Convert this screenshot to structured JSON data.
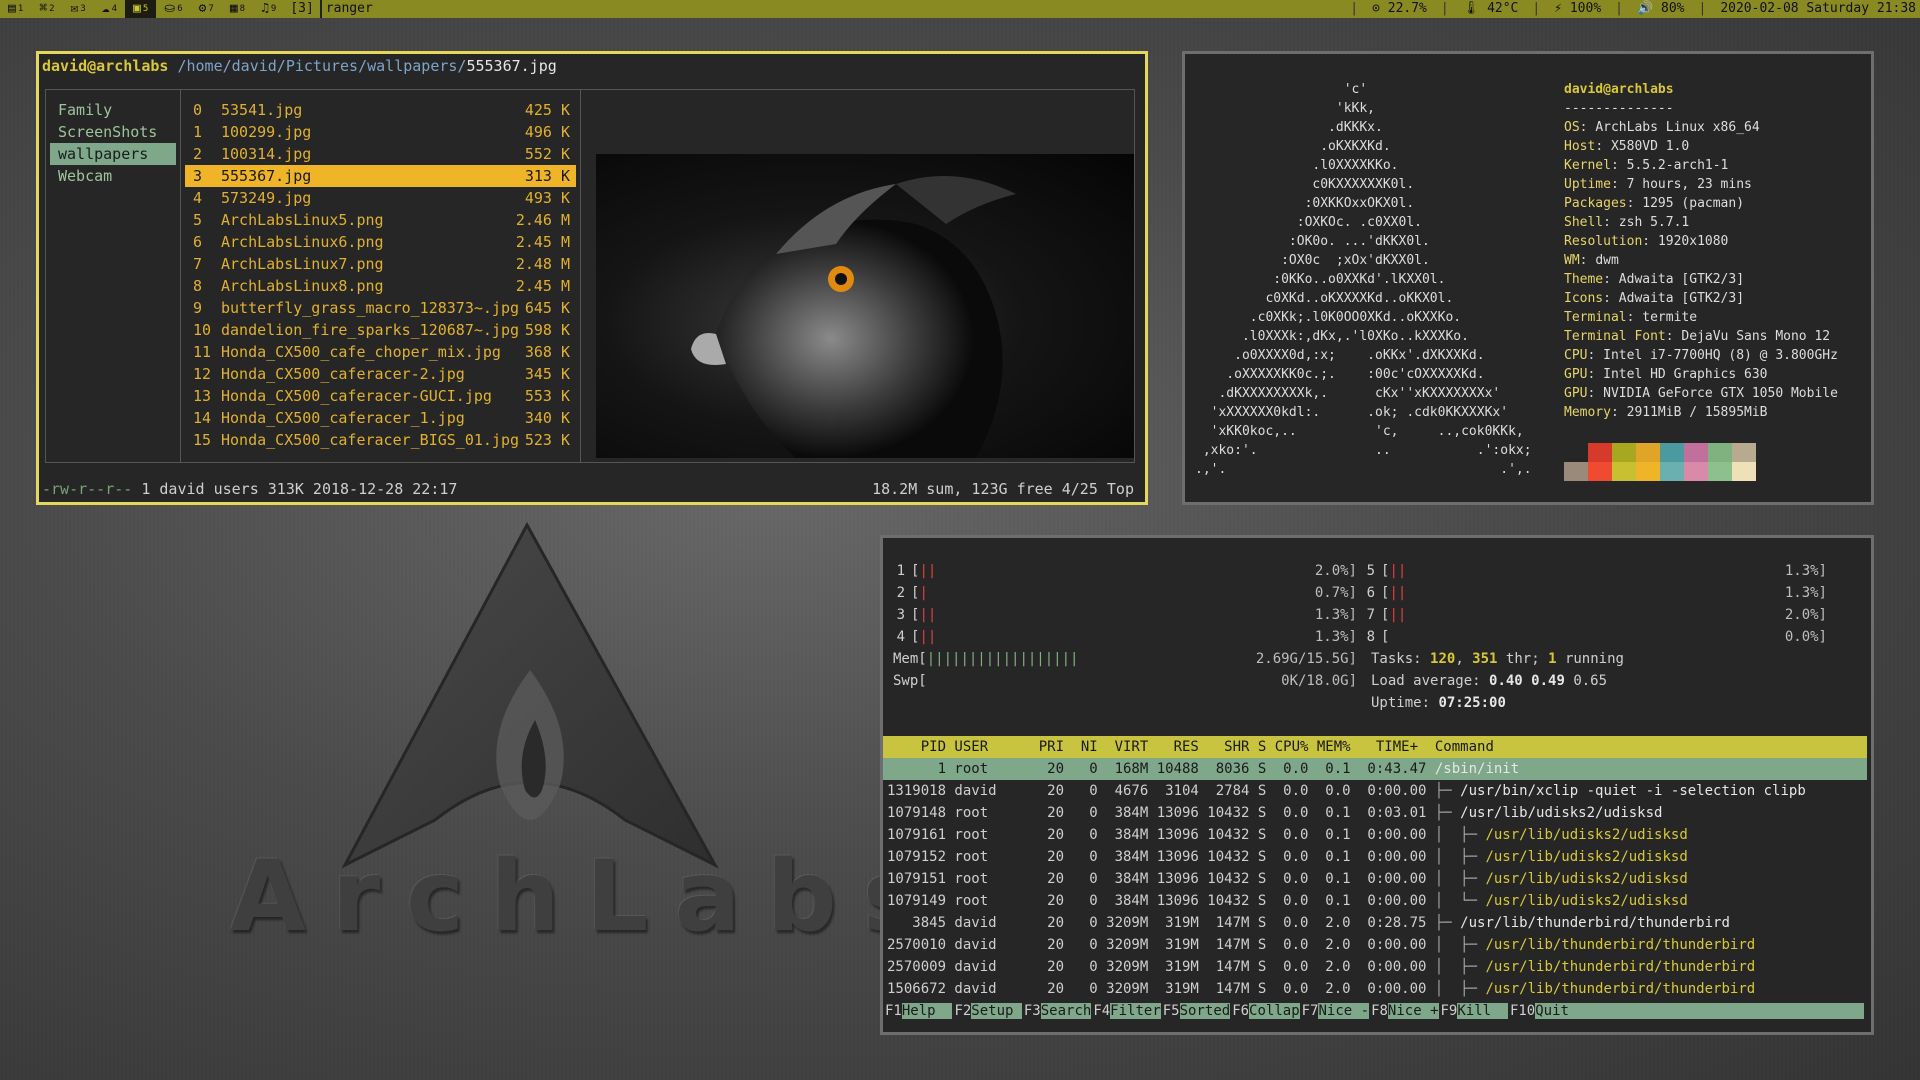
{
  "topbar": {
    "workspaces": [
      {
        "num": "1",
        "icon": "▤",
        "selected": false
      },
      {
        "num": "2",
        "icon": "⌘",
        "selected": false
      },
      {
        "num": "3",
        "icon": "✉",
        "selected": false
      },
      {
        "num": "4",
        "icon": "☁",
        "selected": false
      },
      {
        "num": "5",
        "icon": "▣",
        "selected": true
      },
      {
        "num": "6",
        "icon": "⛀",
        "selected": false
      },
      {
        "num": "7",
        "icon": "⚙",
        "selected": false
      },
      {
        "num": "8",
        "icon": "▦",
        "selected": false
      },
      {
        "num": "9",
        "icon": "♫",
        "selected": false
      }
    ],
    "layout": "[3]",
    "window_title": "ranger",
    "status": {
      "cpu": "22.7%",
      "temp": "42°C",
      "battery": "100%",
      "volume": "80%",
      "datetime": "2020-02-08 Saturday 21:38"
    }
  },
  "ranger": {
    "path_user": "david@archlabs",
    "path_dir": "/home/david/Pictures/wallpapers/",
    "path_file": "555367.jpg",
    "parent_dirs": [
      "Family",
      "ScreenShots",
      "wallpapers",
      "Webcam"
    ],
    "parent_selected": 2,
    "files": [
      {
        "idx": "0",
        "name": "53541.jpg",
        "size": "425 K"
      },
      {
        "idx": "1",
        "name": "100299.jpg",
        "size": "496 K"
      },
      {
        "idx": "2",
        "name": "100314.jpg",
        "size": "552 K"
      },
      {
        "idx": "3",
        "name": "555367.jpg",
        "size": "313 K"
      },
      {
        "idx": "4",
        "name": "573249.jpg",
        "size": "493 K"
      },
      {
        "idx": "5",
        "name": "ArchLabsLinux5.png",
        "size": "2.46 M"
      },
      {
        "idx": "6",
        "name": "ArchLabsLinux6.png",
        "size": "2.45 M"
      },
      {
        "idx": "7",
        "name": "ArchLabsLinux7.png",
        "size": "2.48 M"
      },
      {
        "idx": "8",
        "name": "ArchLabsLinux8.png",
        "size": "2.45 M"
      },
      {
        "idx": "9",
        "name": "butterfly_grass_macro_128373~.jpg",
        "size": "645 K"
      },
      {
        "idx": "10",
        "name": "dandelion_fire_sparks_120687~.jpg",
        "size": "598 K"
      },
      {
        "idx": "11",
        "name": "Honda_CX500_cafe_choper_mix.jpg",
        "size": "368 K"
      },
      {
        "idx": "12",
        "name": "Honda_CX500_caferacer-2.jpg",
        "size": "345 K"
      },
      {
        "idx": "13",
        "name": "Honda_CX500_caferacer-GUCI.jpg",
        "size": "553 K"
      },
      {
        "idx": "14",
        "name": "Honda_CX500_caferacer_1.jpg",
        "size": "340 K"
      },
      {
        "idx": "15",
        "name": "Honda_CX500_caferacer_BIGS_01.jpg",
        "size": "523 K"
      }
    ],
    "file_selected": 3,
    "status_perm": "-rw-r--r--",
    "status_info": "1 david users 313K 2018-12-28 22:17",
    "status_right": "18.2M sum, 123G free  4/25  Top"
  },
  "neofetch": {
    "logo_lines": [
      {
        "t": "                   'c'",
        "c": "#ffffff"
      },
      {
        "t": "                  'kKk,",
        "c": "#ffffff"
      },
      {
        "t": "                 .dKKKx.",
        "c": "#ffffff"
      },
      {
        "t": "                .oKXKXKd.",
        "c": "#ffffff"
      },
      {
        "t": "               .l0XXXXKKo.",
        "c": "#ffffff"
      },
      {
        "t": "               c0KXXXXXXK0l.",
        "c": "#ffffff"
      },
      {
        "t": "              :0XKKOxxOKX0l.",
        "c": "#ffffff"
      },
      {
        "t": "             :OXKOc. .c0XX0l.",
        "c": "#ffffff"
      },
      {
        "t": "            :OK0o. ...'dKKX0l.",
        "c": "#ffffff"
      },
      {
        "t": "           :OX0c  ;xOx'dKXX0l.",
        "c": "#ffffff"
      },
      {
        "t": "          :0KKo..o0XXKd'.lKXX0l.",
        "c": "#ffffff"
      },
      {
        "t": "         c0XKd..oKXXXXKd..oKKX0l.",
        "c": "#ffffff"
      },
      {
        "t": "       .c0XKk;.l0K0OO0XKd..oKXXKo.",
        "c": "#ffffff"
      },
      {
        "t": "      .l0XXXk:,dKx,.'l0XKo..kXXXKo.",
        "c": "#ffffff"
      },
      {
        "t": "     .o0XXXX0d,:x;    .oKKx'.dXKXXKd.",
        "c": "#ffffff"
      },
      {
        "t": "    .oXXXXXKK0c.;.    :00c'cOXXXXXKd.",
        "c": "#ffffff"
      },
      {
        "t": "   .dKXXXXXXXXk,.      cKx''xKXXXXXXXx'",
        "c": "#ffffff"
      },
      {
        "t": "  'xXXXXXX0kdl:.      .ok; .cdk0KKXXXKx'",
        "c": "#ffffff"
      },
      {
        "t": "  'xKK0koc,..          'c,     ..,cok0KKk,",
        "c": "#ffffff"
      },
      {
        "t": " ,xko:'.               ..           .':okx;",
        "c": "#ffffff"
      },
      {
        "t": ".,'.                                   .',.",
        "c": "#ffffff"
      }
    ],
    "header": "david@archlabs",
    "divider": "--------------",
    "fields": [
      {
        "k": "OS",
        "v": "ArchLabs Linux x86_64"
      },
      {
        "k": "Host",
        "v": "X580VD 1.0"
      },
      {
        "k": "Kernel",
        "v": "5.5.2-arch1-1"
      },
      {
        "k": "Uptime",
        "v": "7 hours, 23 mins"
      },
      {
        "k": "Packages",
        "v": "1295 (pacman)"
      },
      {
        "k": "Shell",
        "v": "zsh 5.7.1"
      },
      {
        "k": "Resolution",
        "v": "1920x1080"
      },
      {
        "k": "WM",
        "v": "dwm"
      },
      {
        "k": "Theme",
        "v": "Adwaita [GTK2/3]"
      },
      {
        "k": "Icons",
        "v": "Adwaita [GTK2/3]"
      },
      {
        "k": "Terminal",
        "v": "termite"
      },
      {
        "k": "Terminal Font",
        "v": "DejaVu Sans Mono 12"
      },
      {
        "k": "CPU",
        "v": "Intel i7-7700HQ (8) @ 3.800GHz"
      },
      {
        "k": "GPU",
        "v": "Intel HD Graphics 630"
      },
      {
        "k": "GPU",
        "v": "NVIDIA GeForce GTX 1050 Mobile"
      },
      {
        "k": "Memory",
        "v": "2911MiB / 15895MiB"
      }
    ],
    "palette_top": [
      "#262626",
      "#d83a2a",
      "#a8a820",
      "#e0a428",
      "#4a9aa0",
      "#c0709a",
      "#7fb27f",
      "#b8aa90"
    ],
    "palette_bottom": [
      "#9a8a7a",
      "#f04a30",
      "#c8c030",
      "#f0b428",
      "#6ab0b0",
      "#d88aa8",
      "#8ec08e",
      "#f0e0b8"
    ]
  },
  "htop": {
    "cpus": [
      {
        "n": "1",
        "bars": "||",
        "pct": "2.0%]"
      },
      {
        "n": "2",
        "bars": "|",
        "pct": "0.7%]"
      },
      {
        "n": "3",
        "bars": "||",
        "pct": "1.3%]"
      },
      {
        "n": "4",
        "bars": "||",
        "pct": "1.3%]"
      },
      {
        "n": "5",
        "bars": "||",
        "pct": "1.3%]"
      },
      {
        "n": "6",
        "bars": "||",
        "pct": "1.3%]"
      },
      {
        "n": "7",
        "bars": "||",
        "pct": "2.0%]"
      },
      {
        "n": "8",
        "bars": "",
        "pct": "0.0%]"
      }
    ],
    "mem_label": "Mem",
    "mem_bars": "||||||||||||||||||",
    "mem_value": "2.69G/15.5G]",
    "swp_label": "Swp",
    "swp_value": "0K/18.0G]",
    "tasks_label": "Tasks:",
    "tasks_count": "120",
    "tasks_thr": "351",
    "tasks_thr_label": "thr;",
    "tasks_running": "1",
    "tasks_running_label": "running",
    "load_label": "Load average:",
    "load_1": "0.40",
    "load_5": "0.49",
    "load_15": "0.65",
    "uptime_label": "Uptime:",
    "uptime": "07:25:00",
    "header": "    PID USER      PRI  NI  VIRT   RES   SHR S CPU% MEM%   TIME+  Command",
    "processes": [
      {
        "cols": "      1 root       20   0  168M 10488  8036 S  0.0  0.1  0:43.47 ",
        "tree": "",
        "cmd": "/sbin/init",
        "thread": false
      },
      {
        "cols": "1319018 david      20   0  4676  3104  2784 S  0.0  0.0  0:00.00 ",
        "tree": "├─ ",
        "cmd": "/usr/bin/xclip -quiet -i -selection clipb",
        "thread": false
      },
      {
        "cols": "1079148 root       20   0  384M 13096 10432 S  0.0  0.1  0:03.01 ",
        "tree": "├─ ",
        "cmd": "/usr/lib/udisks2/udisksd",
        "thread": false
      },
      {
        "cols": "1079161 root       20   0  384M 13096 10432 S  0.0  0.1  0:00.00 ",
        "tree": "│  ├─ ",
        "cmd": "/usr/lib/udisks2/udisksd",
        "thread": true
      },
      {
        "cols": "1079152 root       20   0  384M 13096 10432 S  0.0  0.1  0:00.00 ",
        "tree": "│  ├─ ",
        "cmd": "/usr/lib/udisks2/udisksd",
        "thread": true
      },
      {
        "cols": "1079151 root       20   0  384M 13096 10432 S  0.0  0.1  0:00.00 ",
        "tree": "│  ├─ ",
        "cmd": "/usr/lib/udisks2/udisksd",
        "thread": true
      },
      {
        "cols": "1079149 root       20   0  384M 13096 10432 S  0.0  0.1  0:00.00 ",
        "tree": "│  └─ ",
        "cmd": "/usr/lib/udisks2/udisksd",
        "thread": true
      },
      {
        "cols": "   3845 david      20   0 3209M  319M  147M S  0.0  2.0  0:28.75 ",
        "tree": "├─ ",
        "cmd": "/usr/lib/thunderbird/thunderbird",
        "thread": false
      },
      {
        "cols": "2570010 david      20   0 3209M  319M  147M S  0.0  2.0  0:00.00 ",
        "tree": "│  ├─ ",
        "cmd": "/usr/lib/thunderbird/thunderbird",
        "thread": true
      },
      {
        "cols": "2570009 david      20   0 3209M  319M  147M S  0.0  2.0  0:00.00 ",
        "tree": "│  ├─ ",
        "cmd": "/usr/lib/thunderbird/thunderbird",
        "thread": true
      },
      {
        "cols": "1506672 david      20   0 3209M  319M  147M S  0.0  2.0  0:00.00 ",
        "tree": "│  ├─ ",
        "cmd": "/usr/lib/thunderbird/thunderbird",
        "thread": true
      }
    ],
    "selected_process": 0,
    "fkeys": [
      {
        "k": "F1",
        "l": "Help  "
      },
      {
        "k": "F2",
        "l": "Setup "
      },
      {
        "k": "F3",
        "l": "Search"
      },
      {
        "k": "F4",
        "l": "Filter"
      },
      {
        "k": "F5",
        "l": "Sorted"
      },
      {
        "k": "F6",
        "l": "Collap"
      },
      {
        "k": "F7",
        "l": "Nice -"
      },
      {
        "k": "F8",
        "l": "Nice +"
      },
      {
        "k": "F9",
        "l": "Kill  "
      },
      {
        "k": "F10",
        "l": "Quit                                   "
      }
    ]
  },
  "wallpaper": {
    "brand_text": "ArchLabs"
  },
  "colors": {
    "accent_yellow": "#e3d85b",
    "file_orange": "#f0b428",
    "selection_green": "#7fa88b",
    "htop_header": "#c9c43f"
  }
}
